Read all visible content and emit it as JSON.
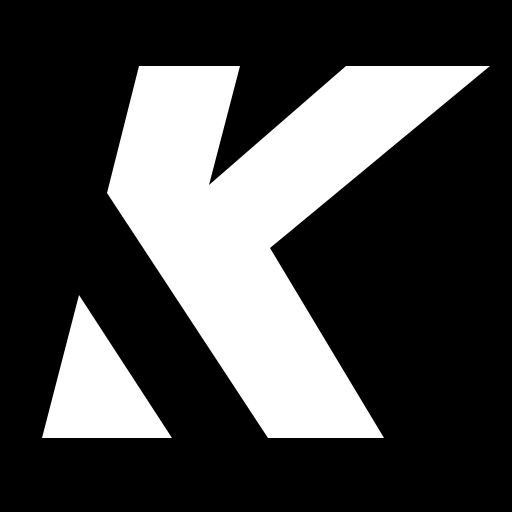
{
  "logo": {
    "icon": "k-letter-logo-icon",
    "background_color": "#000000",
    "foreground_color": "#ffffff"
  }
}
